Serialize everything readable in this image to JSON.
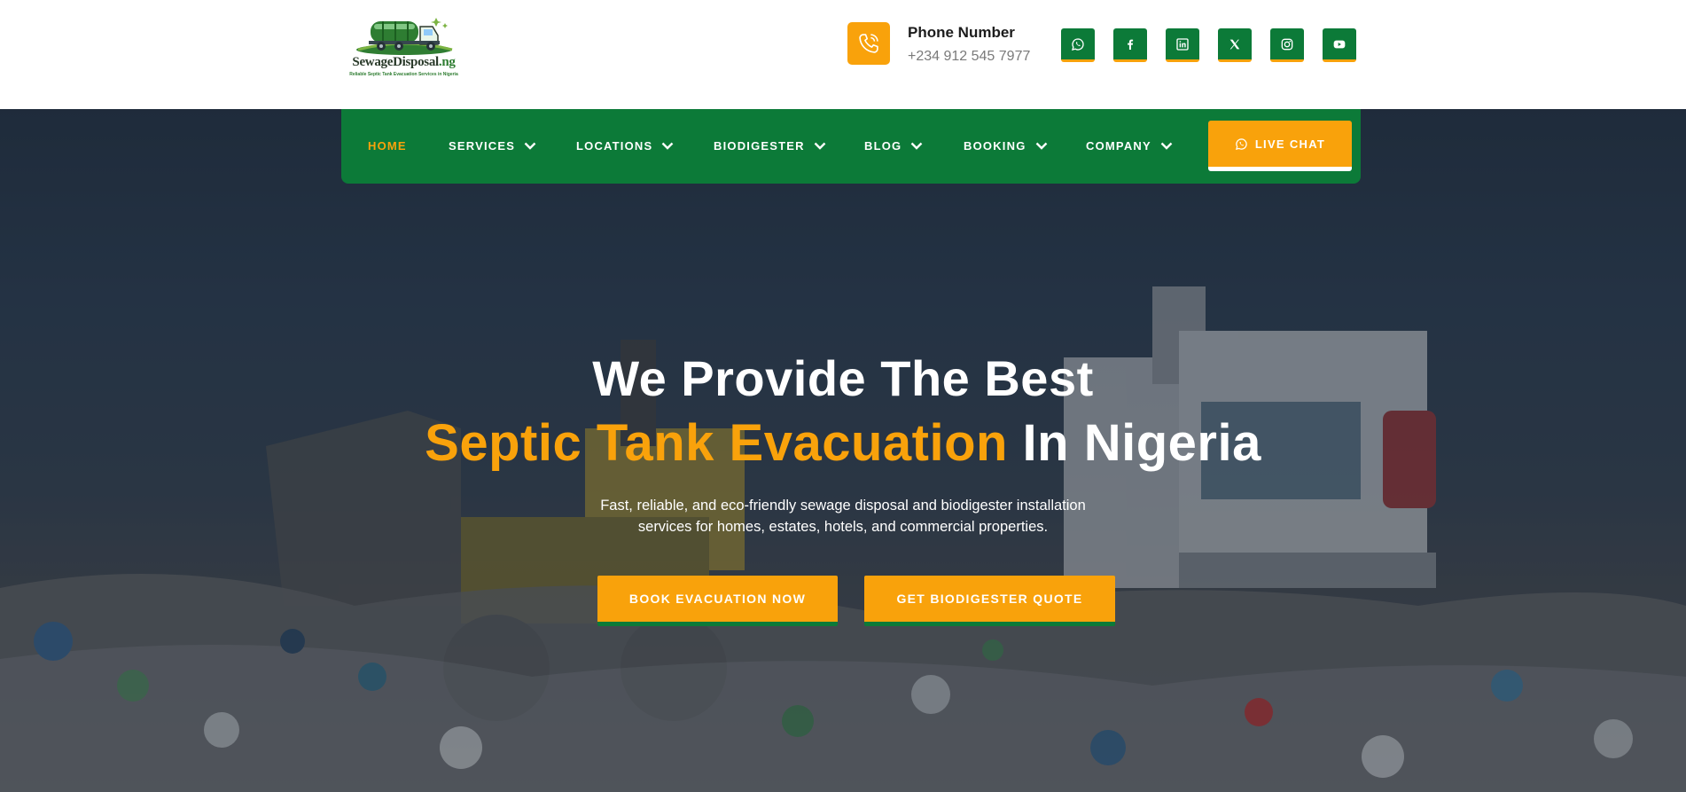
{
  "brand": {
    "name_main": "SewageDisposal",
    "name_tld": ".ng",
    "tagline": "Reliable Septic Tank Evacuation Services in Nigeria"
  },
  "contact": {
    "label": "Phone Number",
    "number": "+234 912 545 7977",
    "icon": "phone-icon"
  },
  "socials": [
    {
      "icon": "whatsapp-icon"
    },
    {
      "icon": "facebook-icon"
    },
    {
      "icon": "linkedin-icon"
    },
    {
      "icon": "x-twitter-icon"
    },
    {
      "icon": "instagram-icon"
    },
    {
      "icon": "youtube-icon"
    }
  ],
  "nav": {
    "items": [
      {
        "label": "HOME",
        "active": true,
        "dropdown": false
      },
      {
        "label": "SERVICES",
        "active": false,
        "dropdown": true
      },
      {
        "label": "LOCATIONS",
        "active": false,
        "dropdown": true
      },
      {
        "label": "BIODIGESTER",
        "active": false,
        "dropdown": true
      },
      {
        "label": "BLOG",
        "active": false,
        "dropdown": true
      },
      {
        "label": "BOOKING",
        "active": false,
        "dropdown": true
      },
      {
        "label": "COMPANY",
        "active": false,
        "dropdown": true
      }
    ],
    "live_chat": "LIVE CHAT"
  },
  "hero": {
    "line1": "We Provide The Best",
    "line2_accent": "Septic Tank Evacuation",
    "line2_rest": " In Nigeria",
    "subtitle_1": "Fast, reliable, and eco-friendly sewage disposal and biodigester installation",
    "subtitle_2": "services for homes, estates, hotels, and commercial properties.",
    "cta_primary": "BOOK EVACUATION NOW",
    "cta_secondary": "GET BIODIGESTER QUOTE"
  },
  "colors": {
    "brand_green": "#0c7a38",
    "accent_orange": "#f9a20b",
    "text_dark": "#1c1c1c",
    "text_muted": "#7a7a7a"
  }
}
